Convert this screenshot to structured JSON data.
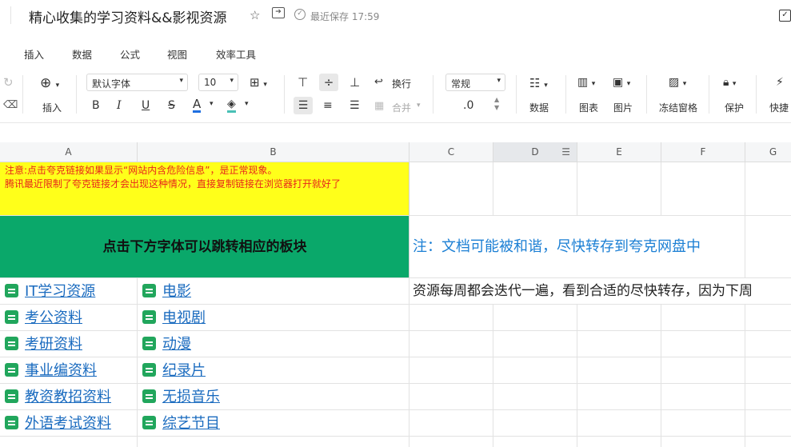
{
  "title_bar": {
    "doc_title": "精心收集的学习资料&&影视资源",
    "star_icon": "star-icon",
    "move_icon": "move-to-folder-icon",
    "save_status": "最近保存 17:59"
  },
  "menu": {
    "items": [
      "插入",
      "数据",
      "公式",
      "视图",
      "效率工具"
    ]
  },
  "toolbar": {
    "insert_label": "插入",
    "font_name": "默认字体",
    "font_size": "10",
    "bold": "B",
    "italic": "I",
    "underline": "U",
    "strike": "S",
    "font_color_glyph": "A",
    "wrap_label": "换行",
    "merge_label": "合并",
    "number_format": "常规",
    "decimal_label": ".0",
    "data_label": "数据",
    "chart_label": "图表",
    "image_label": "图片",
    "freeze_label": "冻结窗格",
    "protect_label": "保护",
    "shortcut_label": "快捷",
    "font_color": "#1f6fe0",
    "fill_color": "#49c0b6"
  },
  "sheet": {
    "columns": [
      "A",
      "B",
      "C",
      "D",
      "E",
      "F",
      "G"
    ],
    "notice_line1": "注意:点击夸克链接如果显示“网站内含危险信息”，是正常现象。",
    "notice_line2": "腾讯最近限制了夸克链接才会出现这种情况，直接复制链接在浏览器打开就好了",
    "header_banner": "点击下方字体可以跳转相应的板块",
    "note_blue": "注：文档可能被和谐，尽快转存到夸克网盘中",
    "note_weekly": "资源每周都会迭代一遍，看到合适的尽快转存，因为下周",
    "col_a_links": [
      "IT学习资源",
      "考公资料",
      "考研资料",
      "事业编资料",
      "教资教招资料",
      "外语考试资料"
    ],
    "col_b_links": [
      "电影",
      "电视剧",
      "动漫",
      "纪录片",
      "无损音乐",
      "综艺节目"
    ],
    "colors": {
      "yellow": "#ffff1a",
      "green": "#0aa86a",
      "notice_red": "#e8261a",
      "link_blue": "#1a6bbf",
      "note_blue": "#1b7fd4"
    }
  }
}
